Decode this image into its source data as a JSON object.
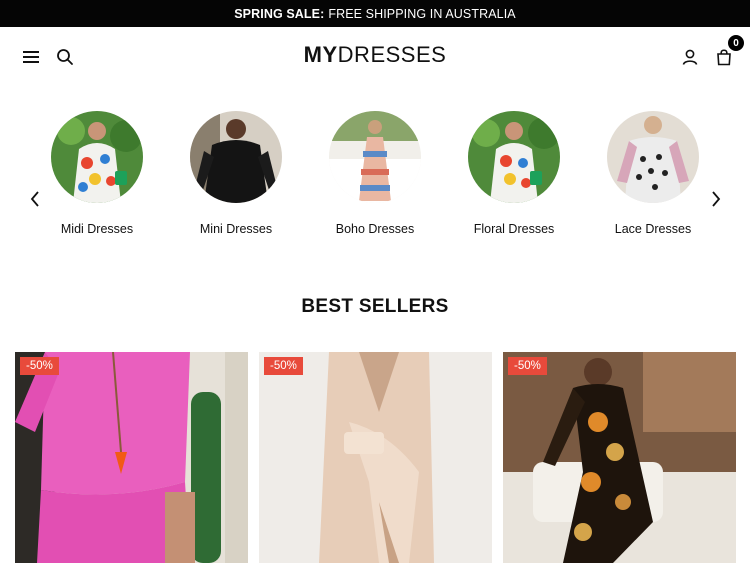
{
  "announcement": {
    "strong": "SPRING SALE:",
    "text": "FREE SHIPPING IN AUSTRALIA"
  },
  "header": {
    "logo_bold": "MY",
    "logo_light": "DRESSES",
    "cart_count": "0",
    "icons": [
      "menu-icon",
      "search-icon",
      "account-icon",
      "cart-icon"
    ]
  },
  "categories": {
    "items": [
      {
        "label": "Midi Dresses",
        "image": "floral-midi-dress-photo"
      },
      {
        "label": "Mini Dresses",
        "image": "black-mini-dress-photo"
      },
      {
        "label": "Boho Dresses",
        "image": "boho-print-dress-photo"
      },
      {
        "label": "Floral Dresses",
        "image": "floral-dress-photo"
      },
      {
        "label": "Lace Dresses",
        "image": "lace-print-dress-photo"
      }
    ]
  },
  "best_sellers": {
    "title": "BEST SELLERS",
    "products": [
      {
        "badge": "-50%",
        "image": "pink-shift-dress-photo"
      },
      {
        "badge": "-50%",
        "image": "beige-wrap-dress-photo"
      },
      {
        "badge": "-50%",
        "image": "printed-wrap-dress-photo"
      }
    ]
  },
  "colors": {
    "announcement_bg": "#050505",
    "badge_bg": "#e84a3b",
    "text": "#111111"
  }
}
